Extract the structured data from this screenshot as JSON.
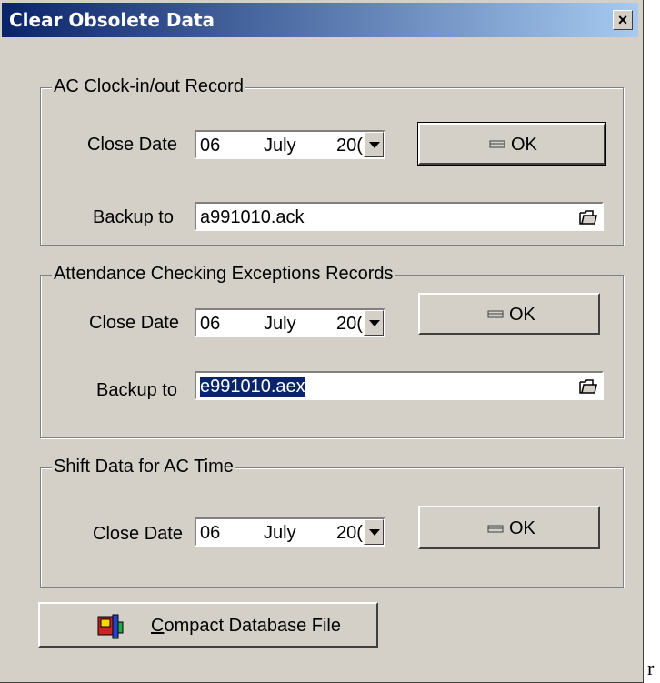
{
  "window": {
    "title": "Clear Obsolete Data",
    "close_label": "×"
  },
  "groups": {
    "clock": {
      "title": "AC Clock-in/out Record",
      "close_label": "Close Date",
      "date": {
        "day": "06",
        "month": "July",
        "year": "20("
      },
      "backup_label": "Backup to",
      "backup_value": "a991010.ack",
      "ok_label": "OK"
    },
    "exceptions": {
      "title": "Attendance Checking Exceptions Records",
      "close_label": "Close Date",
      "date": {
        "day": "06",
        "month": "July",
        "year": "20("
      },
      "backup_label": "Backup to",
      "backup_value": "e991010.aex",
      "ok_label": "OK"
    },
    "shift": {
      "title": "Shift Data for AC Time",
      "close_label": "Close Date",
      "date": {
        "day": "06",
        "month": "July",
        "year": "20("
      },
      "ok_label": "OK"
    }
  },
  "compact_button": {
    "mnemonic": "C",
    "rest": "ompact Database File"
  },
  "stray_char": "r",
  "icons": [
    "close-icon",
    "dropdown-arrow-icon",
    "open-folder-icon",
    "eraser-icon",
    "database-compress-icon"
  ]
}
